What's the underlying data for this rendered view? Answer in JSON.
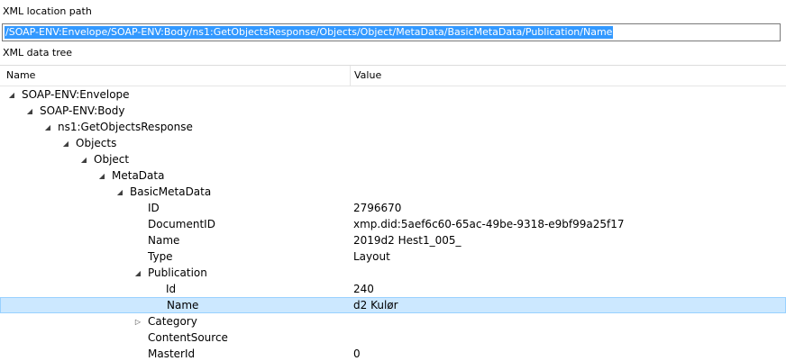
{
  "labels": {
    "location_path": "XML location path",
    "data_tree": "XML data tree"
  },
  "location_path": {
    "value": "/SOAP-ENV:Envelope/SOAP-ENV:Body/ns1:GetObjectsResponse/Objects/Object/MetaData/BasicMetaData/Publication/Name"
  },
  "tree": {
    "columns": {
      "name": "Name",
      "value": "Value"
    },
    "icons": {
      "expanded": "triangle-expanded-icon",
      "collapsed": "triangle-collapsed-icon"
    },
    "rows": [
      {
        "name": "SOAP-ENV:Envelope",
        "value": "",
        "toggle": "expanded",
        "level": 0
      },
      {
        "name": "SOAP-ENV:Body",
        "value": "",
        "toggle": "expanded",
        "level": 1
      },
      {
        "name": "ns1:GetObjectsResponse",
        "value": "",
        "toggle": "expanded",
        "level": 2
      },
      {
        "name": "Objects",
        "value": "",
        "toggle": "expanded",
        "level": 3
      },
      {
        "name": "Object",
        "value": "",
        "toggle": "expanded",
        "level": 4
      },
      {
        "name": "MetaData",
        "value": "",
        "toggle": "expanded",
        "level": 5
      },
      {
        "name": "BasicMetaData",
        "value": "",
        "toggle": "expanded",
        "level": 6
      },
      {
        "name": "ID",
        "value": "2796670",
        "toggle": "none",
        "level": 7
      },
      {
        "name": "DocumentID",
        "value": "xmp.did:5aef6c60-65ac-49be-9318-e9bf99a25f17",
        "toggle": "none",
        "level": 7
      },
      {
        "name": "Name",
        "value": "2019d2 Hest1_005_",
        "toggle": "none",
        "level": 7
      },
      {
        "name": "Type",
        "value": "Layout",
        "toggle": "none",
        "level": 7
      },
      {
        "name": "Publication",
        "value": "",
        "toggle": "expanded",
        "level": 7
      },
      {
        "name": "Id",
        "value": "240",
        "toggle": "none",
        "level": 8
      },
      {
        "name": "Name",
        "value": "d2 Kulør",
        "toggle": "none",
        "level": 8,
        "selected": true
      },
      {
        "name": "Category",
        "value": "",
        "toggle": "collapsed",
        "level": 7
      },
      {
        "name": "ContentSource",
        "value": "",
        "toggle": "none",
        "level": 7
      },
      {
        "name": "MasterId",
        "value": "0",
        "toggle": "none",
        "level": 7
      }
    ]
  }
}
